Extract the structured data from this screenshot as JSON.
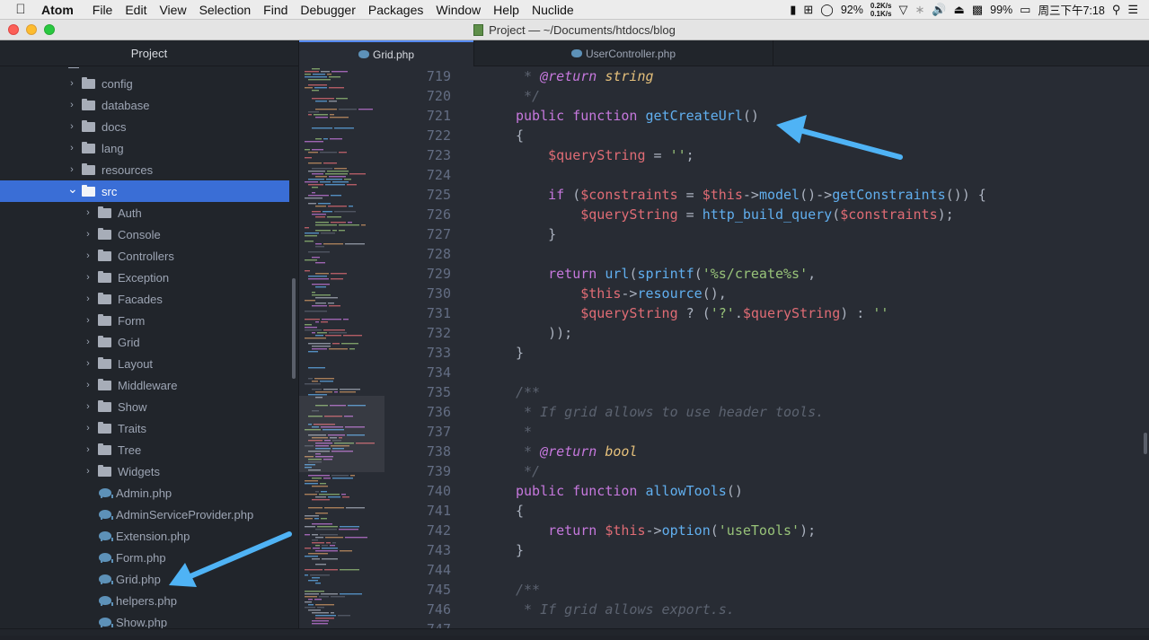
{
  "menubar": {
    "app_name": "Atom",
    "items": [
      "File",
      "Edit",
      "View",
      "Selection",
      "Find",
      "Debugger",
      "Packages",
      "Window",
      "Help",
      "Nuclide"
    ],
    "status": {
      "cpu": "92%",
      "net_up": "0.2K/s",
      "net_down": "0.1K/s",
      "battery": "99%",
      "clock": "周三下午7:18"
    }
  },
  "window": {
    "title": "Project — ~/Documents/htdocs/blog"
  },
  "sidebar": {
    "title": "Project",
    "items": [
      {
        "label": "config",
        "type": "folder",
        "depth": 1,
        "expanded": false
      },
      {
        "label": "database",
        "type": "folder",
        "depth": 1,
        "expanded": false
      },
      {
        "label": "docs",
        "type": "folder",
        "depth": 1,
        "expanded": false
      },
      {
        "label": "lang",
        "type": "folder",
        "depth": 1,
        "expanded": false
      },
      {
        "label": "resources",
        "type": "folder",
        "depth": 1,
        "expanded": false
      },
      {
        "label": "src",
        "type": "folder",
        "depth": 1,
        "expanded": true,
        "selected": true
      },
      {
        "label": "Auth",
        "type": "folder",
        "depth": 2,
        "expanded": false
      },
      {
        "label": "Console",
        "type": "folder",
        "depth": 2,
        "expanded": false
      },
      {
        "label": "Controllers",
        "type": "folder",
        "depth": 2,
        "expanded": false
      },
      {
        "label": "Exception",
        "type": "folder",
        "depth": 2,
        "expanded": false
      },
      {
        "label": "Facades",
        "type": "folder",
        "depth": 2,
        "expanded": false
      },
      {
        "label": "Form",
        "type": "folder",
        "depth": 2,
        "expanded": false
      },
      {
        "label": "Grid",
        "type": "folder",
        "depth": 2,
        "expanded": false
      },
      {
        "label": "Layout",
        "type": "folder",
        "depth": 2,
        "expanded": false
      },
      {
        "label": "Middleware",
        "type": "folder",
        "depth": 2,
        "expanded": false
      },
      {
        "label": "Show",
        "type": "folder",
        "depth": 2,
        "expanded": false
      },
      {
        "label": "Traits",
        "type": "folder",
        "depth": 2,
        "expanded": false
      },
      {
        "label": "Tree",
        "type": "folder",
        "depth": 2,
        "expanded": false
      },
      {
        "label": "Widgets",
        "type": "folder",
        "depth": 2,
        "expanded": false
      },
      {
        "label": "Admin.php",
        "type": "file",
        "depth": 2
      },
      {
        "label": "AdminServiceProvider.php",
        "type": "file",
        "depth": 2
      },
      {
        "label": "Extension.php",
        "type": "file",
        "depth": 2
      },
      {
        "label": "Form.php",
        "type": "file",
        "depth": 2
      },
      {
        "label": "Grid.php",
        "type": "file",
        "depth": 2
      },
      {
        "label": "helpers.php",
        "type": "file",
        "depth": 2
      },
      {
        "label": "Show.php",
        "type": "file",
        "depth": 2
      }
    ]
  },
  "tabs": [
    {
      "label": "Grid.php",
      "active": true
    },
    {
      "label": "UserController.php",
      "active": false
    }
  ],
  "editor": {
    "lines": [
      {
        "n": "719",
        "t": [
          [
            "cm",
            " * "
          ],
          [
            "tag",
            "@return"
          ],
          [
            "cm",
            " "
          ],
          [
            "ty",
            "string"
          ]
        ]
      },
      {
        "n": "720",
        "t": [
          [
            "cm",
            " */"
          ]
        ]
      },
      {
        "n": "721",
        "t": [
          [
            "kw",
            "public function "
          ],
          [
            "fn",
            "getCreateUrl"
          ],
          [
            "pl",
            "()"
          ]
        ]
      },
      {
        "n": "722",
        "t": [
          [
            "pl",
            "{"
          ]
        ]
      },
      {
        "n": "723",
        "t": [
          [
            "pl",
            "    "
          ],
          [
            "var",
            "$queryString"
          ],
          [
            "pl",
            " = "
          ],
          [
            "str",
            "''"
          ],
          [
            "pl",
            ";"
          ]
        ]
      },
      {
        "n": "724",
        "t": []
      },
      {
        "n": "725",
        "t": [
          [
            "pl",
            "    "
          ],
          [
            "kw",
            "if"
          ],
          [
            "pl",
            " ("
          ],
          [
            "var",
            "$constraints"
          ],
          [
            "pl",
            " = "
          ],
          [
            "var",
            "$this"
          ],
          [
            "pl",
            "->"
          ],
          [
            "fn",
            "model"
          ],
          [
            "pl",
            "()->"
          ],
          [
            "fn",
            "getConstraints"
          ],
          [
            "pl",
            "()) {"
          ]
        ]
      },
      {
        "n": "726",
        "t": [
          [
            "pl",
            "        "
          ],
          [
            "var",
            "$queryString"
          ],
          [
            "pl",
            " = "
          ],
          [
            "fn",
            "http_build_query"
          ],
          [
            "pl",
            "("
          ],
          [
            "var",
            "$constraints"
          ],
          [
            "pl",
            ");"
          ]
        ]
      },
      {
        "n": "727",
        "t": [
          [
            "pl",
            "    }"
          ]
        ]
      },
      {
        "n": "728",
        "t": []
      },
      {
        "n": "729",
        "t": [
          [
            "pl",
            "    "
          ],
          [
            "kw",
            "return"
          ],
          [
            "pl",
            " "
          ],
          [
            "fn",
            "url"
          ],
          [
            "pl",
            "("
          ],
          [
            "fn",
            "sprintf"
          ],
          [
            "pl",
            "("
          ],
          [
            "str",
            "'%s/create%s'"
          ],
          [
            "pl",
            ","
          ]
        ]
      },
      {
        "n": "730",
        "t": [
          [
            "pl",
            "        "
          ],
          [
            "var",
            "$this"
          ],
          [
            "pl",
            "->"
          ],
          [
            "fn",
            "resource"
          ],
          [
            "pl",
            "(),"
          ]
        ]
      },
      {
        "n": "731",
        "t": [
          [
            "pl",
            "        "
          ],
          [
            "var",
            "$queryString"
          ],
          [
            "pl",
            " ? ("
          ],
          [
            "str",
            "'?'"
          ],
          [
            "pl",
            "."
          ],
          [
            "var",
            "$queryString"
          ],
          [
            "pl",
            ") : "
          ],
          [
            "str",
            "''"
          ]
        ]
      },
      {
        "n": "732",
        "t": [
          [
            "pl",
            "    ));"
          ]
        ]
      },
      {
        "n": "733",
        "t": [
          [
            "pl",
            "}"
          ]
        ]
      },
      {
        "n": "734",
        "t": []
      },
      {
        "n": "735",
        "t": [
          [
            "cm",
            "/**"
          ]
        ]
      },
      {
        "n": "736",
        "t": [
          [
            "cm",
            " * If grid allows to use header tools."
          ]
        ]
      },
      {
        "n": "737",
        "t": [
          [
            "cm",
            " *"
          ]
        ]
      },
      {
        "n": "738",
        "t": [
          [
            "cm",
            " * "
          ],
          [
            "tag",
            "@return"
          ],
          [
            "cm",
            " "
          ],
          [
            "ty",
            "bool"
          ]
        ]
      },
      {
        "n": "739",
        "t": [
          [
            "cm",
            " */"
          ]
        ]
      },
      {
        "n": "740",
        "t": [
          [
            "kw",
            "public function "
          ],
          [
            "fn",
            "allowTools"
          ],
          [
            "pl",
            "()"
          ]
        ]
      },
      {
        "n": "741",
        "t": [
          [
            "pl",
            "{"
          ]
        ]
      },
      {
        "n": "742",
        "t": [
          [
            "pl",
            "    "
          ],
          [
            "kw",
            "return"
          ],
          [
            "pl",
            " "
          ],
          [
            "var",
            "$this"
          ],
          [
            "pl",
            "->"
          ],
          [
            "fn",
            "option"
          ],
          [
            "pl",
            "("
          ],
          [
            "str",
            "'useTools'"
          ],
          [
            "pl",
            ");"
          ]
        ]
      },
      {
        "n": "743",
        "t": [
          [
            "pl",
            "}"
          ]
        ]
      },
      {
        "n": "744",
        "t": []
      },
      {
        "n": "745",
        "t": [
          [
            "cm",
            "/**"
          ]
        ]
      },
      {
        "n": "746",
        "t": [
          [
            "cm",
            " * If grid allows export.s."
          ]
        ]
      },
      {
        "n": "747",
        "t": []
      }
    ]
  },
  "colors": {
    "accent": "#3a6ed6",
    "arrow": "#4fb3f5"
  }
}
